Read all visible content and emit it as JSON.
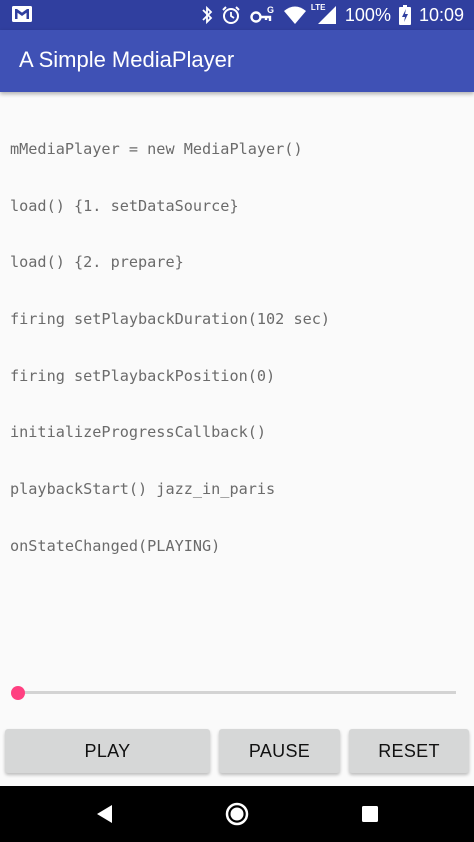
{
  "status_bar": {
    "battery_percent": "100%",
    "time": "10:09",
    "network_type": "LTE",
    "icons": [
      "gmail-icon",
      "bluetooth-icon",
      "alarm-icon",
      "vpn-key-icon",
      "wifi-icon",
      "signal-icon",
      "battery-charging-icon"
    ]
  },
  "app_bar": {
    "title": "A Simple MediaPlayer"
  },
  "log": {
    "lines": [
      "mMediaPlayer = new MediaPlayer()",
      "load() {1. setDataSource}",
      "load() {2. prepare}",
      "firing setPlaybackDuration(102 sec)",
      "firing setPlaybackPosition(0)",
      "initializeProgressCallback()",
      "playbackStart() jazz_in_paris",
      "onStateChanged(PLAYING)"
    ]
  },
  "seekbar": {
    "progress": 0,
    "accent_color": "#ff4081"
  },
  "buttons": {
    "play": "PLAY",
    "pause": "PAUSE",
    "reset": "RESET"
  },
  "nav_bar": {
    "icons": [
      "back-icon",
      "home-icon",
      "recents-icon"
    ]
  },
  "colors": {
    "primary_dark": "#303f9f",
    "primary": "#3f51b5",
    "accent": "#ff4081"
  }
}
